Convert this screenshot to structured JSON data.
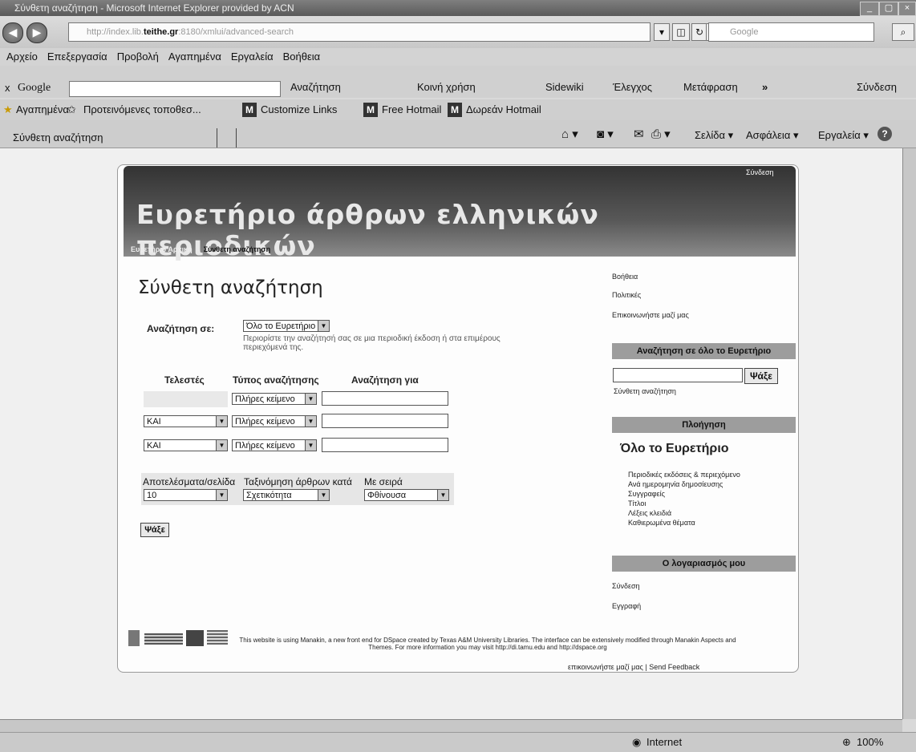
{
  "window": {
    "title": "Σύνθετη αναζήτηση - Microsoft Internet Explorer provided by ACN"
  },
  "addressbar": {
    "url_prefix": "http://index.lib.",
    "url_host": "teithe.gr",
    "url_suffix": ":8180/xmlui/advanced-search",
    "search_placeholder": "Google"
  },
  "menu": [
    "Αρχείο",
    "Επεξεργασία",
    "Προβολή",
    "Αγαπημένα",
    "Εργαλεία",
    "Βοήθεια"
  ],
  "google_toolbar": {
    "label": "Google",
    "close": "x",
    "search": "Αναζήτηση",
    "share": "Κοινή χρήση",
    "sidewiki": "Sidewiki",
    "check": "Έλεγχος",
    "translate": "Μετάφραση",
    "more": "»",
    "signin": "Σύνδεση"
  },
  "favorites": {
    "label": "Αγαπημένα",
    "items": [
      "Προτεινόμενες τοποθεσ...",
      "Customize Links",
      "Free Hotmail",
      "Δωρεάν Hotmail"
    ]
  },
  "tab": {
    "title": "Σύνθετη αναζήτηση"
  },
  "command_bar": [
    "Σελίδα",
    "Ασφάλεια",
    "Εργαλεία"
  ],
  "site": {
    "title": "Ευρετήριο άρθρων ελληνικών περιοδικών",
    "login": "Σύνδεση",
    "breadcrumb_home": "Ευρετήριο Αρχική",
    "breadcrumb_sep": "→",
    "breadcrumb_current": "Σύνθετη αναζήτηση"
  },
  "main": {
    "heading": "Σύνθετη αναζήτηση",
    "scope_label": "Αναζήτηση σε:",
    "scope_value": "Όλο το Ευρετήριο",
    "scope_help": "Περιορίστε την αναζήτησή σας σε μια περιοδική έκδοση ή στα επιμέρους περιεχόμενά της.",
    "col_operators": "Τελεστές",
    "col_type": "Τύπος αναζήτησης",
    "col_query": "Αναζήτηση για",
    "rows": [
      {
        "operator": "",
        "type": "Πλήρες κείμενο",
        "query": ""
      },
      {
        "operator": "ΚΑΙ",
        "type": "Πλήρες κείμενο",
        "query": ""
      },
      {
        "operator": "ΚΑΙ",
        "type": "Πλήρες κείμενο",
        "query": ""
      }
    ],
    "results_label": "Αποτελέσματα/σελίδα",
    "results_value": "10",
    "sort_label": "Ταξινόμηση άρθρων κατά",
    "sort_value": "Σχετικότητα",
    "order_label": "Με σειρά",
    "order_value": "Φθίνουσα",
    "submit": "Ψάξε"
  },
  "sidebar": {
    "links": [
      "Βοήθεια",
      "Πολιτικές",
      "Επικοινωνήστε μαζί μας"
    ],
    "search_head": "Αναζήτηση σε όλο το Ευρετήριο",
    "search_button": "Ψάξε",
    "advanced_link": "Σύνθετη αναζήτηση",
    "browse_head": "Πλοήγηση",
    "browse_title": "Όλο το Ευρετήριο",
    "browse_items": [
      "Περιοδικές εκδόσεις & περιεχόμενο",
      "Ανά ημερομηνία δημοσίευσης",
      "Συγγραφείς",
      "Τίτλοι",
      "Λέξεις κλειδιά",
      "Καθιερωμένα θέματα"
    ],
    "account_head": "Ο λογαριασμός μου",
    "account_items": [
      "Σύνδεση",
      "Εγγραφή"
    ]
  },
  "footer": {
    "text": "This website is using Manakin, a new front end for DSpace created by Texas A&M University Libraries. The interface can be extensively modified through Manakin Aspects and Themes. For more information you may visit http://di.tamu.edu and http://dspace.org",
    "contact": "επικοινωνήστε μαζί μας",
    "sep": "|",
    "feedback": "Send Feedback"
  },
  "statusbar": {
    "zone": "Internet",
    "zoom": "100%"
  }
}
